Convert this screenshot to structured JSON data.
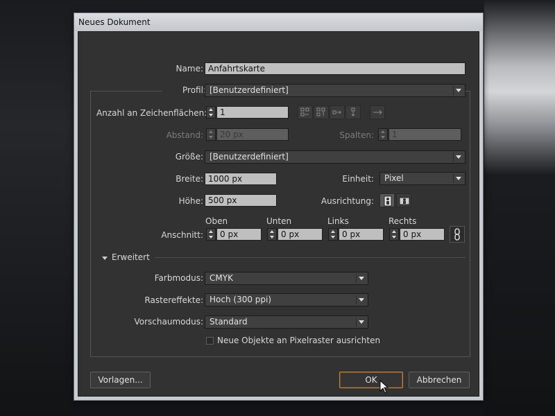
{
  "window": {
    "title": "Neues Dokument"
  },
  "name": {
    "label": "Name:",
    "value": "Anfahrtskarte"
  },
  "profile": {
    "label": "Profil:",
    "value": "[Benutzerdefiniert]"
  },
  "artboards": {
    "label": "Anzahl an Zeichenflächen:",
    "value": "1"
  },
  "spacing": {
    "label": "Abstand:",
    "value": "20 px"
  },
  "columns": {
    "label": "Spalten:",
    "value": "1"
  },
  "size": {
    "label": "Größe:",
    "value": "[Benutzerdefiniert]"
  },
  "width": {
    "label": "Breite:",
    "value": "1000 px"
  },
  "unit": {
    "label": "Einheit:",
    "value": "Pixel"
  },
  "height": {
    "label": "Höhe:",
    "value": "500 px"
  },
  "orientation": {
    "label": "Ausrichtung:"
  },
  "bleed": {
    "label": "Anschnitt:",
    "top": {
      "label": "Oben",
      "value": "0 px"
    },
    "bottom": {
      "label": "Unten",
      "value": "0 px"
    },
    "left": {
      "label": "Links",
      "value": "0 px"
    },
    "right": {
      "label": "Rechts",
      "value": "0 px"
    }
  },
  "advanced": {
    "label": "Erweitert",
    "color_mode": {
      "label": "Farbmodus:",
      "value": "CMYK"
    },
    "raster_effects": {
      "label": "Rastereffekte:",
      "value": "Hoch (300 ppi)"
    },
    "preview_mode": {
      "label": "Vorschaumodus:",
      "value": "Standard"
    },
    "pixel_grid": {
      "label": "Neue Objekte an Pixelraster ausrichten",
      "checked": false
    }
  },
  "buttons": {
    "templates": "Vorlagen...",
    "ok": "OK",
    "cancel": "Abbrechen"
  },
  "colors": {
    "panel": "#323232",
    "field": "#bfbfbf",
    "accent": "#c9853a"
  }
}
